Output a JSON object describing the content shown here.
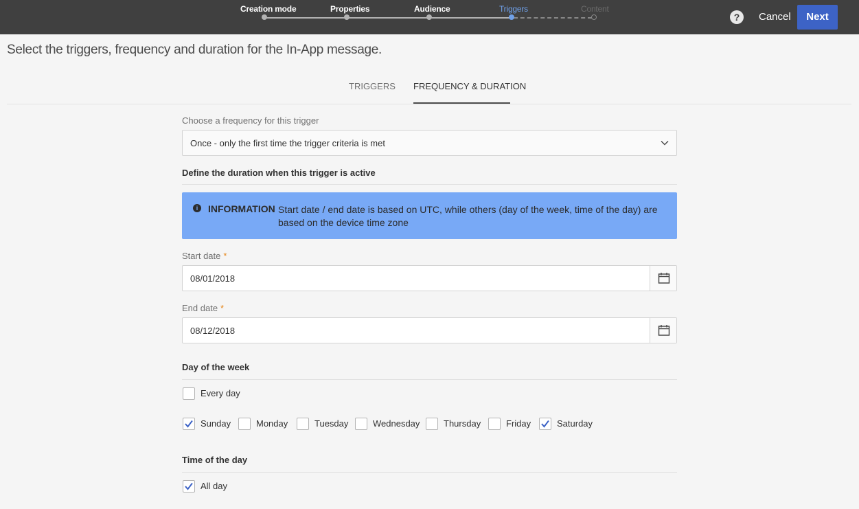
{
  "wizard": {
    "steps": [
      {
        "label": "Creation mode",
        "state": "done"
      },
      {
        "label": "Properties",
        "state": "done"
      },
      {
        "label": "Audience",
        "state": "done"
      },
      {
        "label": "Triggers",
        "state": "active"
      },
      {
        "label": "Content",
        "state": "future"
      }
    ],
    "help_glyph": "?",
    "cancel_label": "Cancel",
    "next_label": "Next"
  },
  "page_title": "Select the triggers, frequency and duration for the In-App message.",
  "tabs": [
    {
      "label": "TRIGGERS",
      "selected": false
    },
    {
      "label": "FREQUENCY & DURATION",
      "selected": true
    }
  ],
  "frequency": {
    "label": "Choose a frequency for this trigger",
    "value": "Once - only the first time the trigger criteria is met"
  },
  "duration": {
    "title": "Define the duration when this trigger is active",
    "info_heading": "INFORMATION",
    "info_text": "Start date / end date is based on UTC, while others (day of the week, time of the day) are based on the device time zone",
    "start_label": "Start date",
    "start_value": "08/01/2018",
    "end_label": "End date",
    "end_value": "08/12/2018",
    "required_mark": "*"
  },
  "day_of_week": {
    "title": "Day of the week",
    "every_day": {
      "label": "Every day",
      "checked": false
    },
    "days": [
      {
        "label": "Sunday",
        "checked": true
      },
      {
        "label": "Monday",
        "checked": false
      },
      {
        "label": "Tuesday",
        "checked": false
      },
      {
        "label": "Wednesday",
        "checked": false
      },
      {
        "label": "Thursday",
        "checked": false
      },
      {
        "label": "Friday",
        "checked": false
      },
      {
        "label": "Saturday",
        "checked": true
      }
    ]
  },
  "time_of_day": {
    "title": "Time of the day",
    "all_day": {
      "label": "All day",
      "checked": true
    }
  },
  "icons": {
    "help": "help-icon",
    "chevron": "chevron-down-icon",
    "calendar": "calendar-icon",
    "info": "info-icon",
    "check": "checkmark-icon"
  },
  "colors": {
    "topbar": "#404040",
    "accent": "#3d63c6",
    "active_step": "#6fa0e8",
    "info_bg": "#78a9f6",
    "required": "#e68619"
  }
}
